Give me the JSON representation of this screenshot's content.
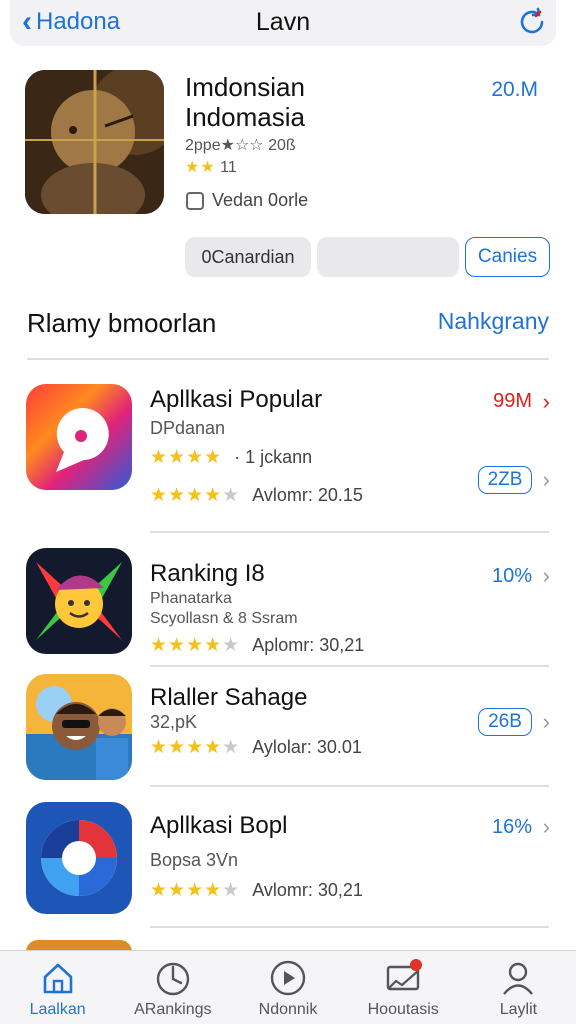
{
  "nav": {
    "back_label": "Hadona",
    "title": "Lavn"
  },
  "app": {
    "name_line1": "Imdonsian",
    "name_line2": "Indomasia",
    "size": "20.M",
    "meta": "2ppe★☆☆ 20ß",
    "rating_count": "11",
    "developer": "Vedan 0orle"
  },
  "buttons": {
    "primary": "0Canardian",
    "secondary": "",
    "outline": "Canies"
  },
  "section": {
    "title": "Rlamy bmoorlan",
    "link": "Nahkgrany"
  },
  "list": [
    {
      "title": "Apllkasi Popular",
      "sub": "DPdanan",
      "rating_text": "· 1 jckann",
      "rating_text2": "Avlomr: 20.15",
      "value": "99M",
      "pill": "2ZB"
    },
    {
      "title": "Ranking I8",
      "sub": "Phanatarka",
      "sub2": "Scyollasn & 8 Ssram",
      "rating_text": "Aplomr: 30,21",
      "value": "10%"
    },
    {
      "title": "Rlaller Sahage",
      "sub": "32,pK",
      "rating_text": "Aylolar: 30.01",
      "pill": "26B"
    },
    {
      "title": "Apllkasi Bopl",
      "sub": "Bopsa 3Vn",
      "rating_text": "Avlomr: 30,21",
      "value": "16%"
    }
  ],
  "tabs": [
    {
      "label": "Laalkan",
      "icon": "home-icon"
    },
    {
      "label": "ARankings",
      "icon": "rankings-icon"
    },
    {
      "label": "Ndonnik",
      "icon": "play-icon"
    },
    {
      "label": "Hooutasis",
      "icon": "notifications-icon"
    },
    {
      "label": "Laylit",
      "icon": "profile-icon"
    }
  ],
  "colors": {
    "accent": "#1f73d6",
    "red": "#d9201e",
    "star": "#f3c11a"
  }
}
